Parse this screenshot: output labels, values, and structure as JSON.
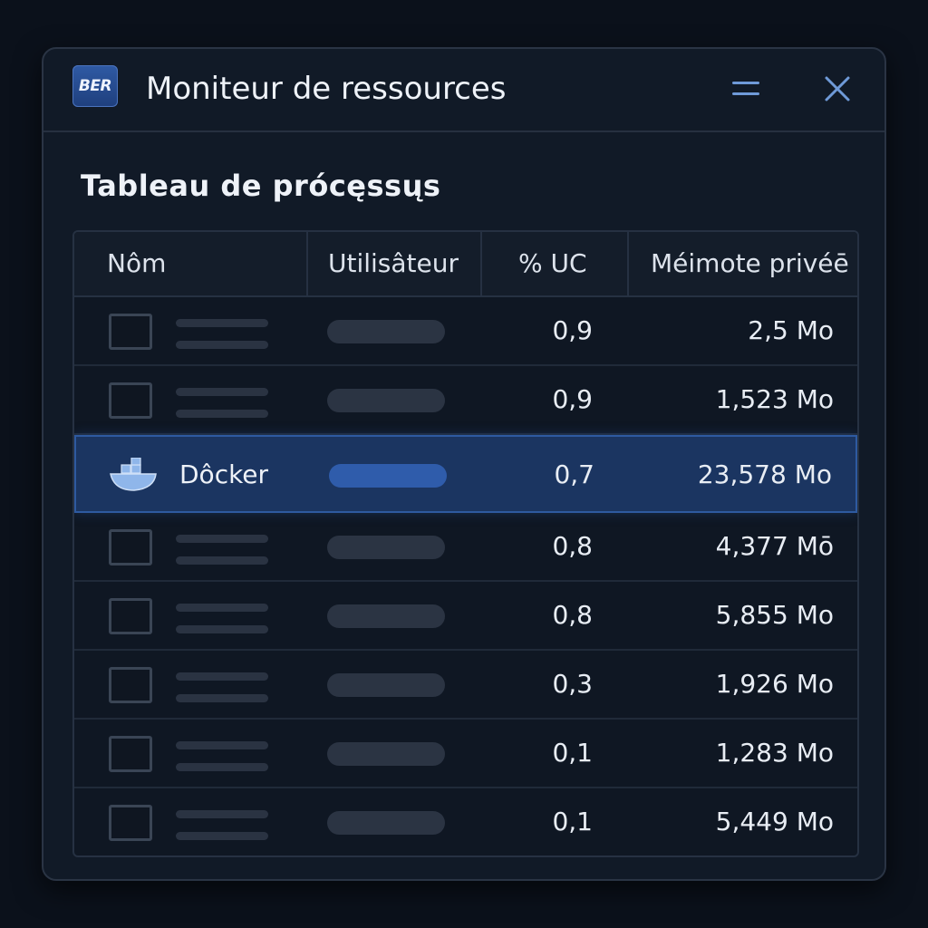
{
  "window": {
    "logo_text": "BER",
    "title": "Moniteur de ressources",
    "min_icon": "minimize-icon",
    "close_icon": "close-icon"
  },
  "section_title": "Tableau de prócęssųs",
  "table": {
    "headers": [
      "Nôm",
      "Utilisâteur",
      "% UC",
      "Méimote privéē"
    ],
    "rows": [
      {
        "name": "",
        "cpu": "0,9",
        "mem": "2,5 Mo",
        "selected": false
      },
      {
        "name": "",
        "cpu": "0,9",
        "mem": "1,523 Mo",
        "selected": false
      },
      {
        "name": "Dôcker",
        "cpu": "0,7",
        "mem": "23,578 Mo",
        "selected": true,
        "icon": "docker-whale-icon"
      },
      {
        "name": "",
        "cpu": "0,8",
        "mem": "4,377 Mō",
        "selected": false
      },
      {
        "name": "",
        "cpu": "0,8",
        "mem": "5,855 Mo",
        "selected": false
      },
      {
        "name": "",
        "cpu": "0,3",
        "mem": "1,926 Mo",
        "selected": false
      },
      {
        "name": "",
        "cpu": "0,1",
        "mem": "1,283 Mo",
        "selected": false
      },
      {
        "name": "",
        "cpu": "0,1",
        "mem": "5,449 Mo",
        "selected": false
      }
    ]
  },
  "colors": {
    "background": "#0b111b",
    "panel": "#111a27",
    "accent": "#6f9ad8",
    "selected_row": "#1b3561"
  }
}
